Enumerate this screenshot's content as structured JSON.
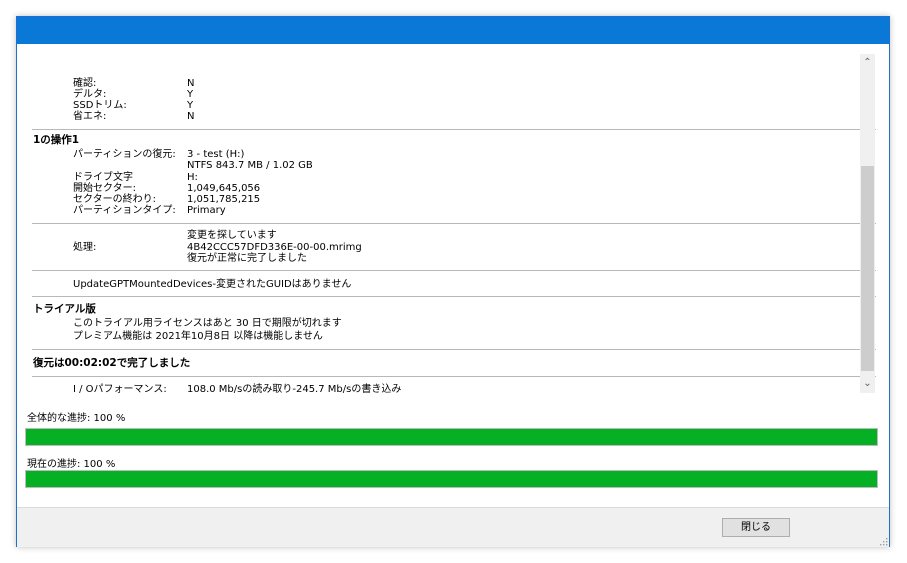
{
  "colors": {
    "title_bar": "#0a78d7",
    "progress_fill": "#06b025"
  },
  "log": {
    "options": [
      {
        "label": "確認:",
        "value": "N"
      },
      {
        "label": "デルタ:",
        "value": "Y"
      },
      {
        "label": "SSDトリム:",
        "value": "Y"
      },
      {
        "label": "省エネ:",
        "value": "N"
      }
    ],
    "operation_heading": "1の操作1",
    "partition_restore_label": "パーティションの復元:",
    "partition_restore_value1": "3 - test (H:)",
    "partition_restore_value2": "NTFS 843.7 MB / 1.02 GB",
    "details": [
      {
        "label": "ドライブ文字",
        "value": "H:"
      },
      {
        "label": "開始セクター:",
        "value": "1,049,645,056"
      },
      {
        "label": "セクターの終わり:",
        "value": "1,051,785,215"
      },
      {
        "label": "パーティションタイプ:",
        "value": "Primary"
      }
    ],
    "processing_label": "処理:",
    "processing_lines": [
      "変更を探しています",
      "4B42CCC57DFD336E-00-00.mrimg",
      "復元が正常に完了しました"
    ],
    "gpt_message": "UpdateGPTMountedDevices-変更されたGUIDはありません",
    "trial_heading": "トライアル版",
    "trial_line1": "このトライアル用ライセンスはあと 30 日で期限が切れます",
    "trial_line2": "プレミアム機能は 2021年10月8日 以降は機能しません",
    "complete_heading": "復元は00:02:02で完了しました",
    "io_label": "I / Oパフォーマンス:",
    "io_value": "108.0 Mb/sの読み取り-245.7 Mb/sの書き込み"
  },
  "scrollbar": {
    "up_icon": "chevron-up-icon",
    "down_icon": "chevron-down-icon",
    "up_glyph": "⌃",
    "down_glyph": "⌄"
  },
  "progress": {
    "overall_label": "全体的な進捗:  100 %",
    "overall_percent": 100,
    "current_label": "現在の進捗:  100 %",
    "current_percent": 100
  },
  "footer": {
    "close_label": "閉じる"
  }
}
